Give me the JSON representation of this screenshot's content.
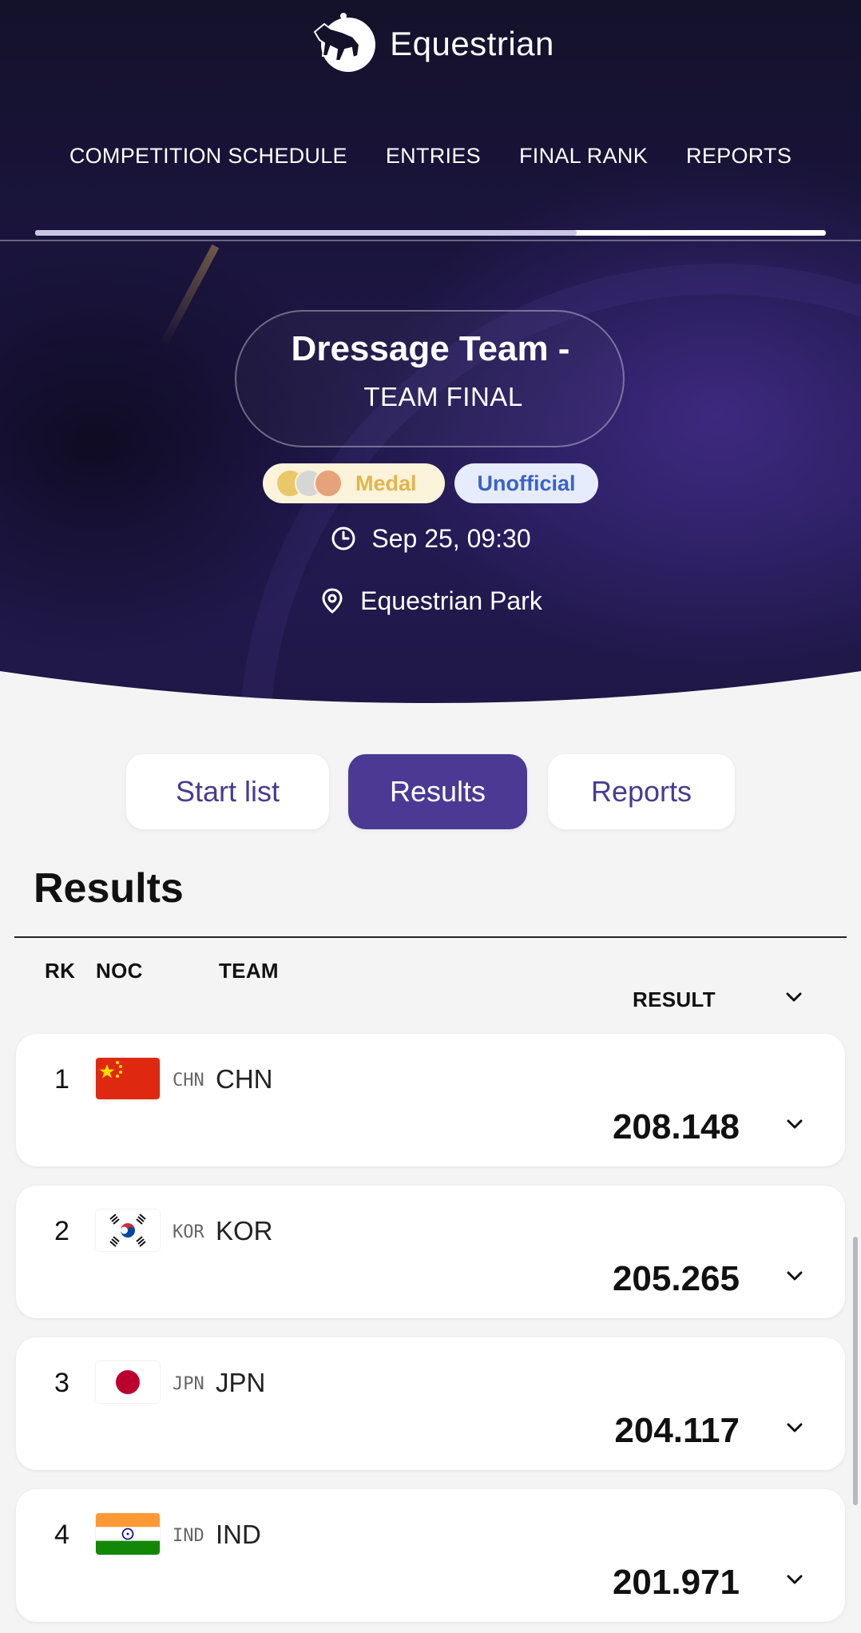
{
  "app": {
    "title": "Equestrian"
  },
  "top_nav": {
    "items": [
      "COMPETITION SCHEDULE",
      "ENTRIES",
      "FINAL RANK",
      "REPORTS"
    ]
  },
  "event": {
    "title": "Dressage Team  -",
    "subtitle": "TEAM FINAL",
    "medal_badge": "Medal",
    "status_badge": "Unofficial",
    "datetime": "Sep 25, 09:30",
    "venue": "Equestrian Park"
  },
  "tabs": {
    "items": [
      "Start list",
      "Results",
      "Reports"
    ],
    "active": "Results"
  },
  "results": {
    "title": "Results",
    "columns": {
      "rank": "RK",
      "noc": "NOC",
      "team": "TEAM",
      "result": "RESULT"
    },
    "rows": [
      {
        "rank": "1",
        "noc_code": "CHN",
        "team": "CHN",
        "result": "208.148",
        "flag": "china-flag"
      },
      {
        "rank": "2",
        "noc_code": "KOR",
        "team": "KOR",
        "result": "205.265",
        "flag": "korea-flag"
      },
      {
        "rank": "3",
        "noc_code": "JPN",
        "team": "JPN",
        "result": "204.117",
        "flag": "japan-flag"
      },
      {
        "rank": "4",
        "noc_code": "IND",
        "team": "IND",
        "result": "201.971",
        "flag": "india-flag"
      }
    ]
  },
  "colors": {
    "accent": "#4b3994",
    "hero_bg": "#1b1540",
    "medal_text": "#e3b44c",
    "unofficial_text": "#3a63c9"
  }
}
